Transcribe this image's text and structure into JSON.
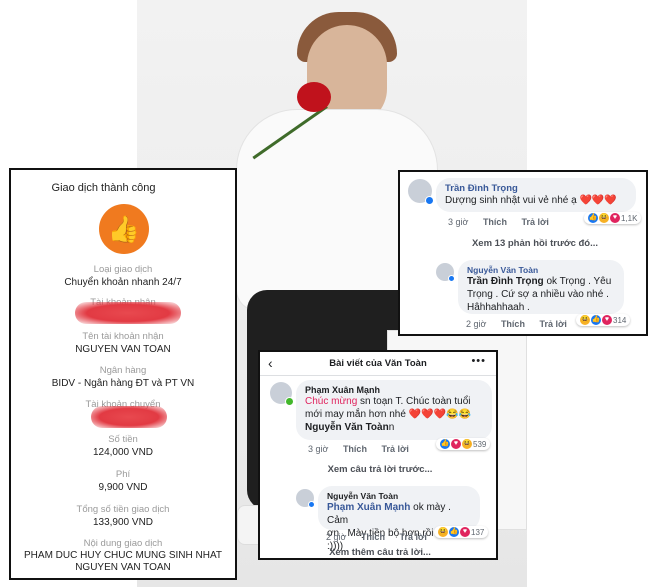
{
  "receipt": {
    "title": "Giao dịch thành công",
    "type_label": "Loại giao dịch",
    "type_value": "Chuyển khoản nhanh 24/7",
    "account_label": "Tài khoản nhận",
    "recipient_name_label": "Tên tài khoản nhận",
    "recipient_name_value": "NGUYEN VAN TOAN",
    "bank_label": "Ngân hàng",
    "bank_value": "BIDV - Ngân hàng ĐT và PT VN",
    "source_label": "Tài khoản chuyển",
    "amount_label": "Số tiền",
    "amount_value": "124,000 VND",
    "fee_label": "Phí",
    "fee_value": "9,900 VND",
    "total_label": "Tổng số tiền giao dịch",
    "total_value": "133,900 VND",
    "content_label": "Nội dung giao dịch",
    "content_line1": "PHAM DUC HUY  CHUC MUNG SINH NHAT",
    "content_line2": "NGUYEN VAN TOAN"
  },
  "card1": {
    "author": "Trần Đình Trọng",
    "comment": "Dượng sinh nhật vui vẻ nhé ạ ",
    "hearts": "❤️❤️❤️",
    "time": "3 giờ",
    "like": "Thích",
    "reply": "Trả lời",
    "reactions_count": "1,1K",
    "view_more": "Xem 13 phản hồi trước đó...",
    "reply_author": "Nguyễn Văn Toàn",
    "reply_mention": "Trần Đình Trọng",
    "reply_text_a": " ok Trọng . Yêu",
    "reply_text_b": "Trọng .  Cứ sợ a nhiều vào nhé .",
    "reply_text_c": "Hâhhahhaah .",
    "reply_time": "2 giờ",
    "reply_like": "Thích",
    "reply_reply": "Trả lời",
    "reply_reactions": "314"
  },
  "card2": {
    "header": "Bài viết của Văn Toàn",
    "author": "Phạm Xuân Mạnh",
    "chuc_mung": "Chúc mừng",
    "comment_a": " sn toạn T. Chúc toàn tuổi",
    "comment_b": "mới may mắn hơn nhé ",
    "hearts": "❤️❤️❤️😂😂",
    "mention": "Nguyễn Văn Toàn",
    "mention_suffix": "n",
    "time": "3 giờ",
    "like": "Thích",
    "reply": "Trả lời",
    "reactions_count": "539",
    "view_prev": "Xem câu trả lời trước...",
    "reply_author": "Nguyễn Văn Toàn",
    "reply_mention": "Phạm Xuân Mạnh",
    "reply_text_a": " ok mày .  Cảm",
    "reply_text_b": "ơn . Mày tiền bộ hơn rồi đấy :))))",
    "reply_time": "2 giờ",
    "reply_like": "Thích",
    "reply_reply": "Trả lời",
    "reply_reactions": "137",
    "view_more": "Xem thêm câu trả lời..."
  },
  "colors": {
    "accent": "#f07a1f",
    "link": "#385898",
    "heart": "#e0245e",
    "like": "#1877f2",
    "redaction": "#e23a43"
  },
  "icons": [
    "thumbs-up-icon",
    "back-arrow-icon",
    "more-dots-icon",
    "like-reaction-icon",
    "love-reaction-icon",
    "haha-reaction-icon"
  ]
}
